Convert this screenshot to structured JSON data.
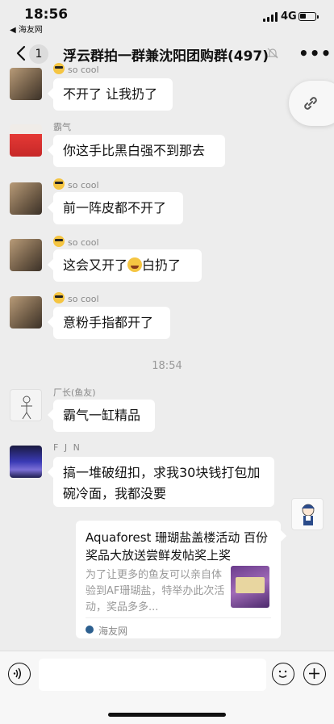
{
  "status_bar": {
    "time": "18:56",
    "back_app": "◀ 海友网",
    "network": "4G"
  },
  "nav": {
    "unread_count": "1",
    "title": "浮云群拍一群兼沈阳团购群(497)"
  },
  "messages": [
    {
      "sender": "so cool",
      "text": "不开了 让我扔了"
    },
    {
      "sender": "霸气",
      "text": "你这手比黑白强不到那去"
    },
    {
      "sender": "so cool",
      "text": "前一阵皮都不开了"
    },
    {
      "sender": "so cool",
      "text": "这会又开了",
      "text_after": "白扔了"
    },
    {
      "sender": "so cool",
      "text": "意粉手指都开了"
    },
    {
      "sender": "厂长(鱼友)",
      "text": "霸气一缸精品"
    },
    {
      "sender": "F J N",
      "text": "搞一堆破纽扣，求我30块钱打包加碗冷面，我都没要"
    }
  ],
  "timestamp": "18:54",
  "link_card": {
    "title": "Aquaforest 珊瑚盐盖楼活动 百份奖品大放送尝鲜发帖奖上奖",
    "description": "为了让更多的鱼友可以亲自体验到AF珊瑚盐，特举办此次活动，奖品多多...",
    "source": "海友网"
  },
  "icons": {
    "back": "chevron-left-icon",
    "mute": "bell-off-icon",
    "more": "more-dots-icon",
    "link": "link-icon",
    "voice": "voice-icon",
    "emoji": "emoji-icon",
    "plus": "plus-icon"
  }
}
